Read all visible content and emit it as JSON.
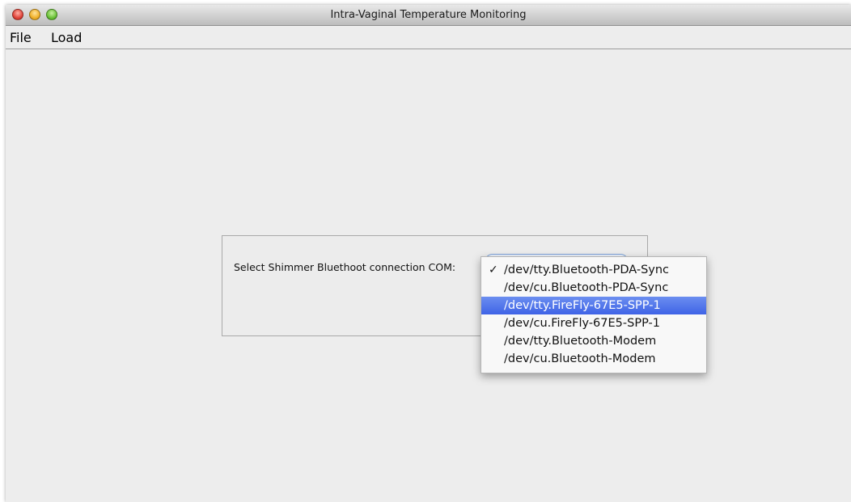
{
  "window": {
    "title": "Intra-Vaginal Temperature Monitoring"
  },
  "menubar": {
    "items": [
      {
        "label": "File"
      },
      {
        "label": "Load"
      }
    ]
  },
  "panel": {
    "label": "Select Shimmer Bluethoot connection COM:"
  },
  "dropdown": {
    "check_glyph": "✓",
    "checked_index": 0,
    "highlighted_index": 2,
    "options": [
      {
        "label": "/dev/tty.Bluetooth-PDA-Sync"
      },
      {
        "label": "/dev/cu.Bluetooth-PDA-Sync"
      },
      {
        "label": "/dev/tty.FireFly-67E5-SPP-1"
      },
      {
        "label": "/dev/cu.FireFly-67E5-SPP-1"
      },
      {
        "label": "/dev/tty.Bluetooth-Modem"
      },
      {
        "label": "/dev/cu.Bluetooth-Modem"
      }
    ]
  },
  "colors": {
    "highlight": "#4a6ff0",
    "window_bg": "#ededed"
  }
}
